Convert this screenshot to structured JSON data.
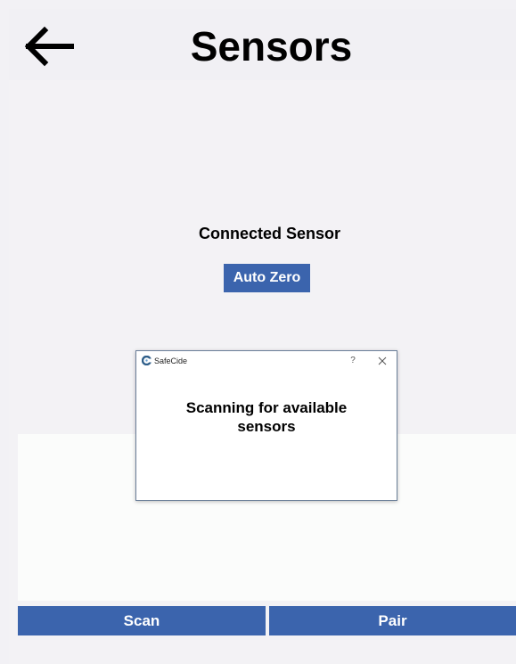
{
  "header": {
    "title": "Sensors",
    "back_icon": "arrow-left-icon"
  },
  "main": {
    "connected_label": "Connected Sensor",
    "auto_zero_label": "Auto Zero"
  },
  "actions": {
    "scan_label": "Scan",
    "pair_label": "Pair"
  },
  "dialog": {
    "app_name": "SafeCide",
    "help_label": "?",
    "close_icon": "close-icon",
    "message_line1": "Scanning for available",
    "message_line2": "sensors"
  },
  "colors": {
    "accent": "#3b64ad",
    "background": "#f2f1f5",
    "list_background": "#fbfcfb"
  }
}
